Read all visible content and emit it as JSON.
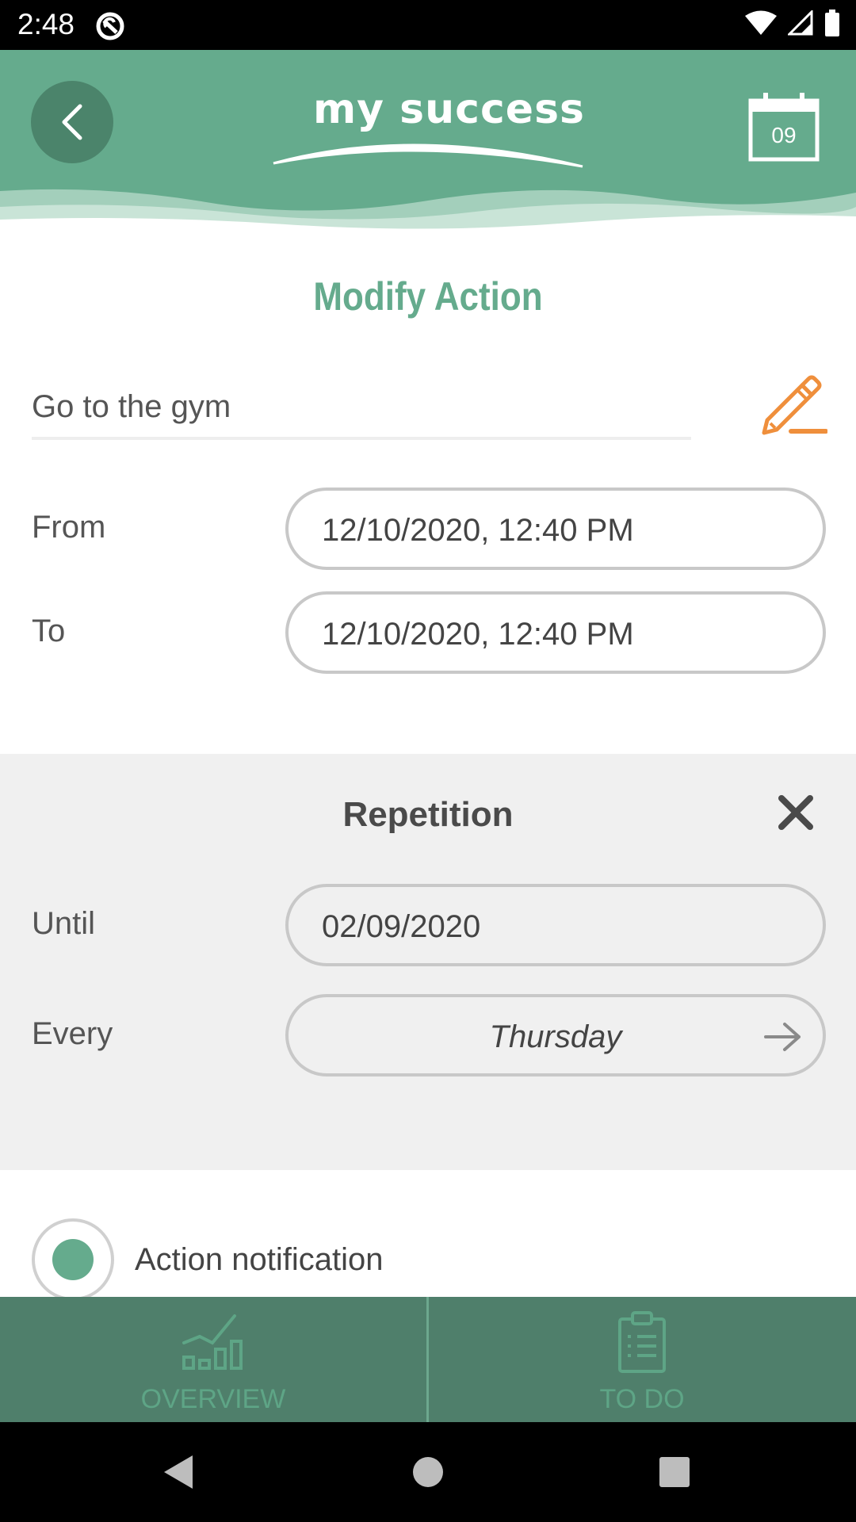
{
  "status_bar": {
    "time": "2:48"
  },
  "header": {
    "logo_text": "my success",
    "calendar_day": "09"
  },
  "page": {
    "title": "Modify Action",
    "action_name": "Go to the gym"
  },
  "schedule": {
    "from_label": "From",
    "from_value": "12/10/2020, 12:40 PM",
    "to_label": "To",
    "to_value": "12/10/2020, 12:40 PM"
  },
  "repetition": {
    "title": "Repetition",
    "until_label": "Until",
    "until_value": "02/09/2020",
    "every_label": "Every",
    "every_value": "Thursday"
  },
  "notification": {
    "label": "Action notification",
    "selected": true
  },
  "tabs": [
    {
      "label": "OVERVIEW",
      "icon": "chart-icon"
    },
    {
      "label": "TO DO",
      "icon": "clipboard-icon"
    }
  ],
  "colors": {
    "brand": "#65ab8d",
    "brand_dark": "#4f7f6b",
    "accent_edit": "#ef8f3c",
    "panel_bg": "#f0f0f0"
  }
}
